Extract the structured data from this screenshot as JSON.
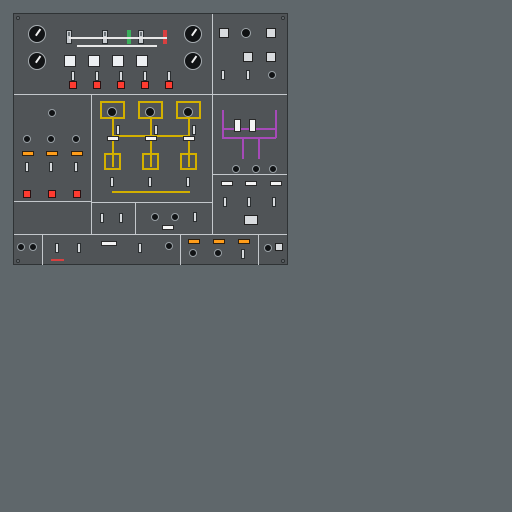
{
  "page": {
    "background_color": "#5f676b",
    "panel_color": "#505457",
    "accent_colors": {
      "amber": "#ff9d1a",
      "red": "#ff3b30",
      "yellow": "#d3b000",
      "purple": "#a64ab8",
      "green": "#3bb15c"
    }
  },
  "panel": {
    "sections": {
      "top_left_label": "",
      "top_right_label": "",
      "middle_left_label": "",
      "middle_center_label": "",
      "middle_right_label": "",
      "bottom_left_label": "",
      "bottom_center_label": "",
      "bottom_right_label": ""
    },
    "icons": [
      "gauge-icon",
      "toggle-switch-icon",
      "push-button-icon",
      "warning-light-icon",
      "knob-icon",
      "screw-icon"
    ]
  }
}
